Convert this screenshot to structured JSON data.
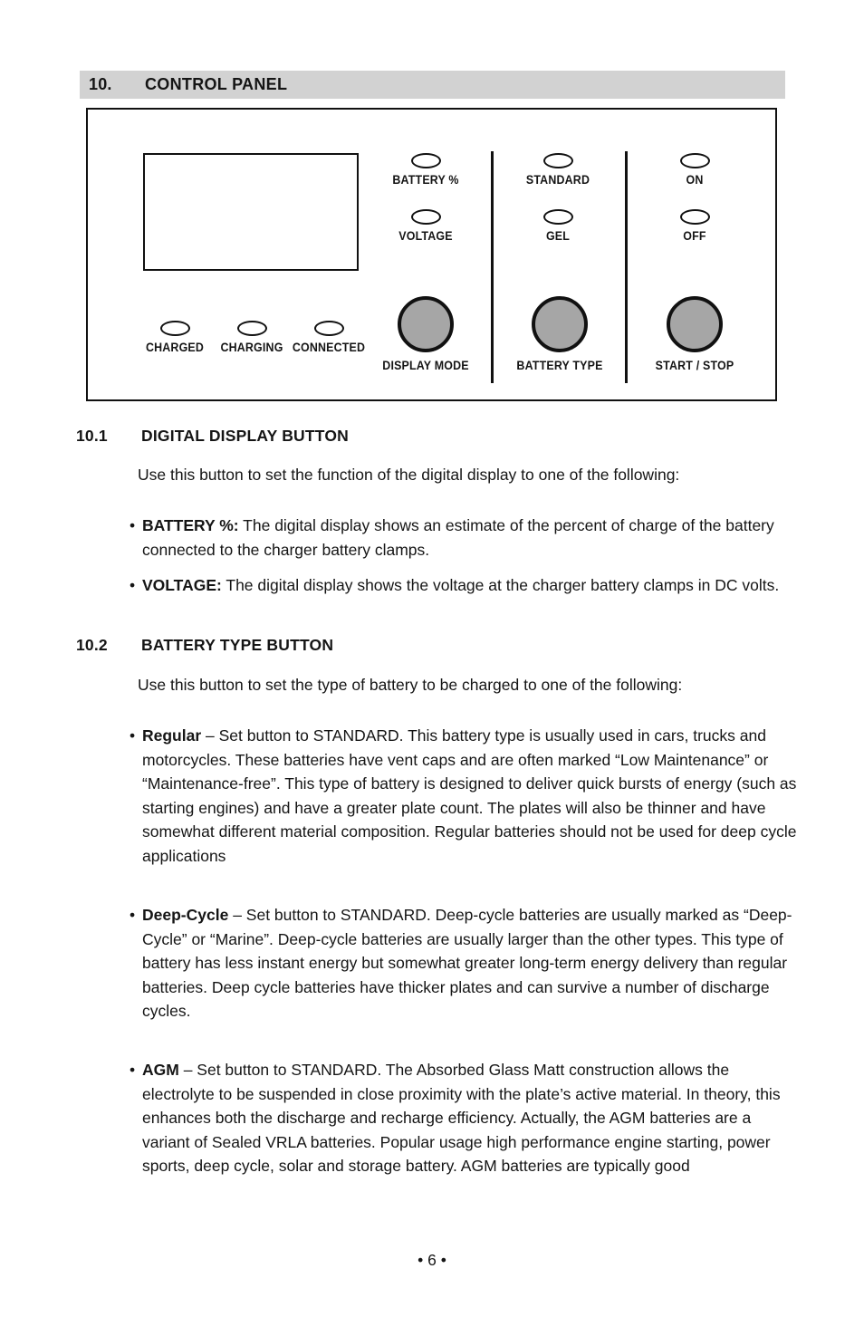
{
  "section": {
    "number": "10.",
    "title": "CONTROL PANEL"
  },
  "panel": {
    "name": "control-panel-diagram",
    "display_screen_label": "",
    "led_indicators": [
      {
        "id": "battery-percent",
        "label": "BATTERY %"
      },
      {
        "id": "voltage",
        "label": "VOLTAGE"
      },
      {
        "id": "standard",
        "label": "STANDARD"
      },
      {
        "id": "gel",
        "label": "GEL"
      },
      {
        "id": "on",
        "label": "ON"
      },
      {
        "id": "off",
        "label": "OFF"
      },
      {
        "id": "charged",
        "label": "CHARGED"
      },
      {
        "id": "charging",
        "label": "CHARGING"
      },
      {
        "id": "connected",
        "label": "CONNECTED"
      }
    ],
    "buttons": [
      {
        "id": "display-mode",
        "label": "DISPLAY MODE"
      },
      {
        "id": "battery-type",
        "label": "BATTERY TYPE"
      },
      {
        "id": "start-stop",
        "label": "START / STOP"
      }
    ],
    "colors": {
      "button_fill": "#a6a6a6",
      "outline": "#111111",
      "band": "#d2d2d2"
    }
  },
  "subsections": [
    {
      "number": "10.1",
      "title": "DIGITAL DISPLAY BUTTON",
      "intro": "Use this button to set the function of the digital display to one of the following:",
      "bullets": [
        {
          "dot": "•",
          "term": "BATTERY %:",
          "body": " The digital display shows an estimate of the percent of charge of the battery connected to the charger battery clamps."
        },
        {
          "dot": "•",
          "term": "VOLTAGE:",
          "body": " The digital display shows the voltage at the charger battery clamps in DC volts."
        }
      ]
    },
    {
      "number": "10.2",
      "title": "BATTERY TYPE BUTTON",
      "intro": "Use this button to set the type of battery to be charged to one of the following:",
      "bullets": [
        {
          "dot": "•",
          "term": "Regular",
          "body": " – Set button to STANDARD. This battery type is usually used in cars, trucks and motorcycles. These batteries have vent caps and are often marked “Low Maintenance” or “Maintenance-free”. This type of battery is designed to deliver quick bursts of energy (such as starting engines) and have a greater plate count. The plates will also be thinner and have somewhat different material composition. Regular batteries should not be used for deep cycle applications"
        },
        {
          "dot": "•",
          "term": "Deep-Cycle",
          "body": " – Set button to STANDARD. Deep-cycle batteries are usually marked as “Deep-Cycle” or “Marine”. Deep-cycle batteries are usually larger than the other types. This type of battery has less instant energy but somewhat greater long-term energy delivery than regular batteries. Deep cycle batteries have thicker plates and can survive a number of discharge cycles."
        },
        {
          "dot": "•",
          "term": "AGM",
          "body": " – Set button to STANDARD. The Absorbed Glass Matt construction allows the electrolyte to be suspended in close proximity with the plate’s active material. In theory, this enhances both the discharge and recharge efficiency. Actually, the AGM batteries are a variant of Sealed VRLA batteries. Popular usage high performance engine starting, power sports, deep cycle, solar and storage battery. AGM batteries are typically good"
        }
      ]
    }
  ],
  "footer": {
    "page": "• 6 •"
  }
}
